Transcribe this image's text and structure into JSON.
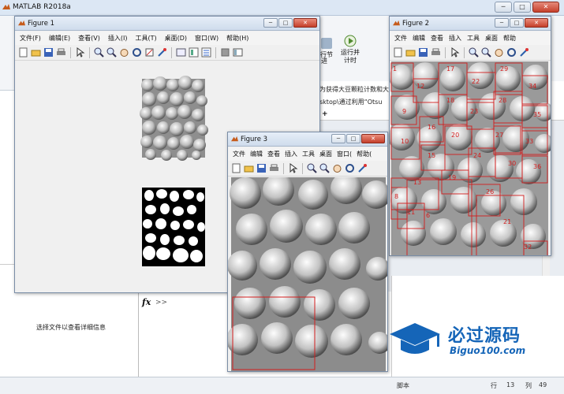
{
  "app": {
    "title": "MATLAB R2018a"
  },
  "main_window": {
    "toolstrip": {
      "buttons": [
        "行节",
        "运行并\n计时"
      ],
      "nav": "进"
    },
    "editor_lines": [
      "为获得大豆颗粒计数和大",
      "sktop\\通过利用“Otsu"
    ],
    "left_panel_info": "选择文件以查看详细信息",
    "command_prompt": "fx",
    "command_chevron": ">>",
    "status": {
      "script": "脚本",
      "row_label": "行",
      "row": "13",
      "col_label": "列",
      "col": "49"
    }
  },
  "figures": {
    "figure1": {
      "title": "Figure 1",
      "menu": [
        "文件(F)",
        "编辑(E)",
        "查看(V)",
        "插入(I)",
        "工具(T)",
        "桌面(D)",
        "窗口(W)",
        "帮助(H)"
      ]
    },
    "figure2": {
      "title": "Figure 2",
      "menu": [
        "文件",
        "编辑",
        "查看",
        "插入",
        "工具",
        "桌面",
        "帮助"
      ],
      "labels": [
        "1",
        "12",
        "17",
        "22",
        "29",
        "34",
        "9",
        "18",
        "23",
        "28",
        "16",
        "20",
        "27",
        "33",
        "10",
        "35",
        "15",
        "24",
        "30",
        "36",
        "19",
        "13",
        "8",
        "11",
        "6",
        "26",
        "21",
        "32"
      ]
    },
    "figure3": {
      "title": "Figure 3",
      "menu": [
        "文件",
        "编辑",
        "查看",
        "插入",
        "工具",
        "桌面",
        "窗口(",
        "帮助("
      ]
    }
  },
  "window_buttons": {
    "minimize": "─",
    "maximize": "□",
    "close": "✕"
  },
  "watermark": {
    "line1": "必过源码",
    "line2": "Biguo100.com"
  },
  "colors": {
    "accent_red": "#d21e1e",
    "title_bar": "#dce7f4",
    "brand_blue": "#1565b8"
  }
}
